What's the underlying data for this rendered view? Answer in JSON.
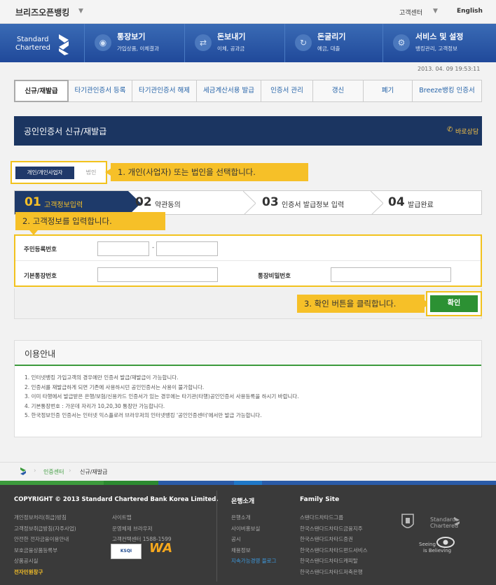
{
  "topbar": {
    "brand": "브리즈오픈뱅킹",
    "customer_center": "고객센터",
    "english": "English"
  },
  "nav": {
    "logo_line1": "Standard",
    "logo_line2": "Chartered",
    "items": [
      {
        "title": "통장보기",
        "sub": "가입상품, 이체결과",
        "icon": "eye-icon"
      },
      {
        "title": "돈보내기",
        "sub": "이체, 공과금",
        "icon": "transfer-icon"
      },
      {
        "title": "돈굴리기",
        "sub": "예금, 대출",
        "icon": "growth-icon"
      },
      {
        "title": "서비스 및 설정",
        "sub": "뱅킹관리, 고객정보",
        "icon": "gear-icon"
      }
    ]
  },
  "datetime": "2013. 04. 09 19:53:11",
  "tabs": [
    "신규/재발급",
    "타기관인증서 등록",
    "타기관인증서 해제",
    "세금계산서용 발급",
    "인증서 관리",
    "갱신",
    "폐기",
    "Breeze뱅킹 인증서"
  ],
  "page": {
    "title": "공인인증서 신규/재발급",
    "consult": "바로상담"
  },
  "type_select": {
    "individual": "개인/개인사업자",
    "corporate": "법인"
  },
  "callouts": {
    "step1": "1. 개인(사업자) 또는 법인을 선택합니다.",
    "step2": "2. 고객정보를 입력합니다.",
    "step3": "3. 확인 버튼을 클릭합니다."
  },
  "steps": [
    {
      "num": "01",
      "label": "고객정보입력"
    },
    {
      "num": "02",
      "label": "약관동의"
    },
    {
      "num": "03",
      "label": "인증서 발급정보 입력"
    },
    {
      "num": "04",
      "label": "발급완료"
    }
  ],
  "form": {
    "resident_label": "주민등록번호",
    "account_label": "기본통장번호",
    "password_label": "통장비밀번호",
    "resident_sep": "-",
    "confirm": "확인"
  },
  "info": {
    "title": "이용안내",
    "items": [
      "1.  인터넷뱅킹 가입고객의 경우에만 인증서 발급/재발급이 가능합니다.",
      "2.  인증서를 재발급하게 되면 기존에 사용하시던 공인인증서는 사용이 불가합니다.",
      "3.  이미 타행에서 발급받은 은행/보험/신용카드 인증서가 있는 경우에는 타기관(타행)공인인증서 사용등록을 하시기 바랍니다.",
      "4.  기본통장번호 : 가운데 자리가 10,20,30 통장만 가능합니다.",
      "5.  한국정보인증 인증서는 인터넷 익스플로러 브라우저의 인터넷뱅킹 '공인인증센터'에서만 발급 가능합니다."
    ]
  },
  "breadcrumb": {
    "c1": "인증센터",
    "c2": "신규/재발급"
  },
  "footer": {
    "copyright": "COPYRIGHT © 2013 Standard Chartered Bank Korea Limited.",
    "col1": [
      "개인정보처리(취급)방침",
      "고객정보취급방침(자주사업)",
      "안전한 전자금융이용안내",
      "보호금융상품등록부",
      "상품공시실"
    ],
    "col1_highlight": "전자민원창구",
    "col2": [
      "사이트맵",
      "운영체제 브라우저",
      "고객컨택센터 1588-1599"
    ],
    "bank_title": "은행소개",
    "bank_items": [
      "은행소개",
      "사이버홍보실",
      "공시",
      "채용정보"
    ],
    "bank_highlight": "지속가능경영 블로그",
    "family_title": "Family Site",
    "family_items": [
      "스탠다드차타드그룹",
      "한국스탠다드차타드금융지주",
      "한국스탠다드차타드증권",
      "한국스탠다드차타드펀드서비스",
      "한국스탠다드차타드캐피탈",
      "한국스탠다드차타드저축은행"
    ],
    "ksqi": "KSQI",
    "wa": "WA",
    "sc_logo_line1": "Standard",
    "sc_logo_line2": "Chartered",
    "seeing1": "Seeing",
    "seeing2": "is Believing"
  },
  "colors": {
    "navy": "#1b3561",
    "nav_blue": "#2a5ba8",
    "highlight": "#f6c028",
    "green": "#2c9133"
  }
}
